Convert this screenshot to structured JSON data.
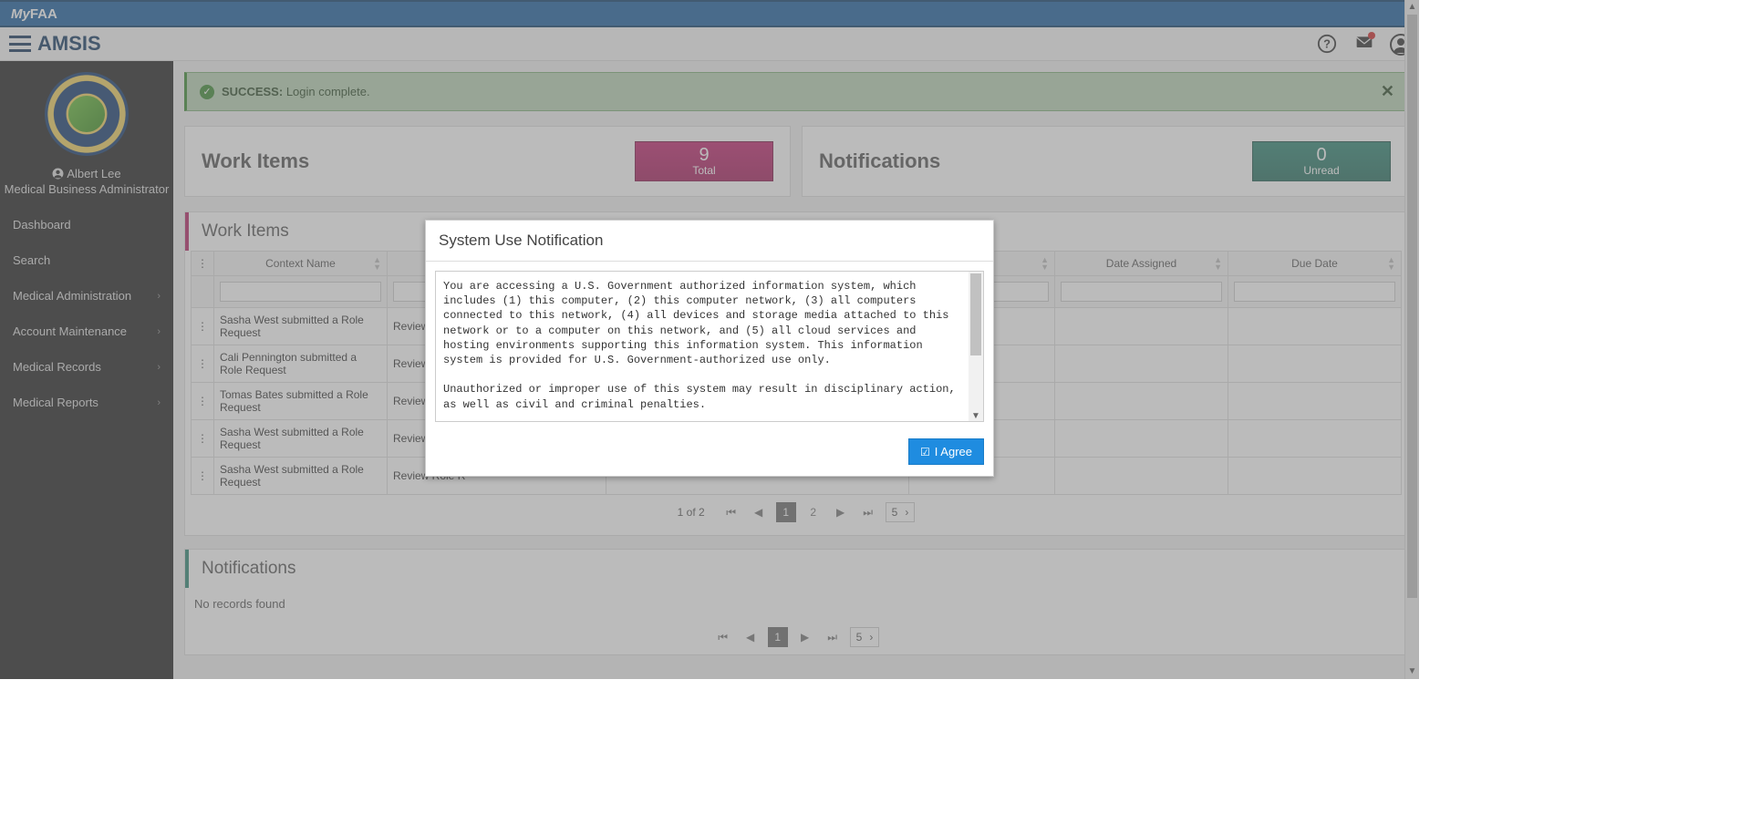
{
  "topbar": {
    "title_prefix": "My",
    "title_bold": "FAA"
  },
  "brand": "AMSIS",
  "user": {
    "name": "Albert Lee",
    "role": "Medical Business Administrator"
  },
  "nav": [
    {
      "label": "Dashboard",
      "has_children": false
    },
    {
      "label": "Search",
      "has_children": false
    },
    {
      "label": "Medical Administration",
      "has_children": true
    },
    {
      "label": "Account Maintenance",
      "has_children": true
    },
    {
      "label": "Medical Records",
      "has_children": true
    },
    {
      "label": "Medical Reports",
      "has_children": true
    }
  ],
  "alert": {
    "prefix": "SUCCESS:",
    "message": "Login complete."
  },
  "summary": {
    "work_items": {
      "title": "Work Items",
      "count": "9",
      "label": "Total"
    },
    "notifications": {
      "title": "Notifications",
      "count": "0",
      "label": "Unread"
    }
  },
  "work_panel": {
    "title": "Work Items",
    "columns": [
      "Context Name",
      "",
      "",
      "",
      "Date Assigned",
      "Due Date"
    ],
    "rows": [
      {
        "menu": "⋮",
        "context": "Sasha West submitted a Role Request",
        "c2": "Review Role R"
      },
      {
        "menu": "⋮",
        "context": "Cali Pennington submitted a Role Request",
        "c2": "Review Role R"
      },
      {
        "menu": "⋮",
        "context": "Tomas Bates submitted a Role Request",
        "c2": "Review Role R"
      },
      {
        "menu": "⋮",
        "context": "Sasha West submitted a Role Request",
        "c2": "Review Role R"
      },
      {
        "menu": "⋮",
        "context": "Sasha West submitted a Role Request",
        "c2": "Review Role R"
      }
    ],
    "pager": {
      "info": "1 of 2",
      "pages": [
        "1",
        "2"
      ],
      "page_size": "5"
    }
  },
  "notif_panel": {
    "title": "Notifications",
    "empty": "No records found",
    "pager": {
      "pages": [
        "1"
      ],
      "page_size": "5"
    }
  },
  "modal": {
    "title": "System Use Notification",
    "text": "You are accessing a U.S. Government authorized information system, which includes (1) this computer, (2) this computer network, (3) all computers connected to this network, (4) all devices and storage media attached to this network or to a computer on this network, and (5) all cloud services and hosting environments supporting this information system. This information system is provided for U.S. Government-authorized use only.\n\nUnauthorized or improper use of this system may result in disciplinary action, as well as civil and criminal penalties.\n\nBy logging in and using this information system, you understand and consent to the following:\n\n• You have no reasonable expectation of privacy regarding communications or data transiting or stored on this information system.",
    "agree": "I Agree"
  }
}
